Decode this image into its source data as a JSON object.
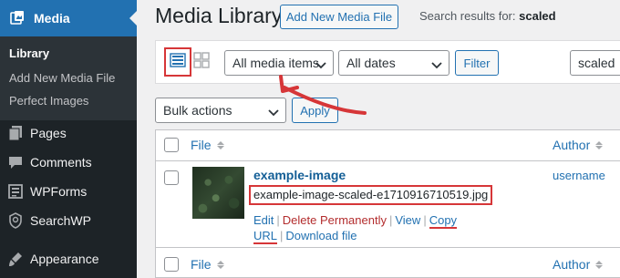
{
  "sidebar": {
    "top": {
      "label": "Media",
      "icon": "media-icon"
    },
    "submenu": [
      {
        "label": "Library",
        "current": true
      },
      {
        "label": "Add New Media File",
        "current": false
      },
      {
        "label": "Perfect Images",
        "current": false
      }
    ],
    "items": [
      {
        "label": "Pages",
        "icon": "pages-icon"
      },
      {
        "label": "Comments",
        "icon": "comments-icon"
      },
      {
        "label": "WPForms",
        "icon": "wpforms-icon"
      },
      {
        "label": "SearchWP",
        "icon": "searchwp-icon"
      },
      {
        "label": "Appearance",
        "icon": "appearance-icon"
      }
    ]
  },
  "header": {
    "title": "Media Library",
    "add_new_label": "Add New Media File",
    "search_results_prefix": "Search results for:",
    "search_term": "scaled"
  },
  "toolbar": {
    "media_type_selected": "All media items",
    "dates_selected": "All dates",
    "filter_label": "Filter",
    "search_value": "scaled"
  },
  "bulk": {
    "selected": "Bulk actions",
    "apply_label": "Apply"
  },
  "table": {
    "columns": [
      "File",
      "Author"
    ],
    "rows": [
      {
        "title": "example-image",
        "filename": "example-image-scaled-e1710916710519.jpg",
        "actions": {
          "edit": "Edit",
          "delete": "Delete Permanently",
          "view": "View",
          "copy_url": "Copy URL",
          "download": "Download file"
        },
        "author": "username"
      }
    ]
  },
  "colors": {
    "accent": "#2271b1",
    "sidebar_bg": "#1d2327",
    "highlight": "#d63638",
    "delete": "#b32d2e"
  }
}
